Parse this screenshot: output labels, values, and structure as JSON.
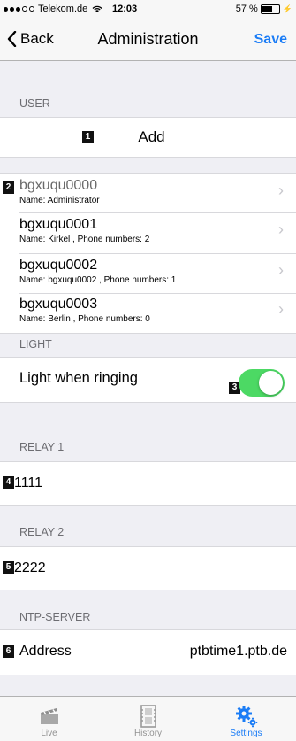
{
  "status_bar": {
    "carrier": "Telekom.de",
    "time": "12:03",
    "battery": "57 %"
  },
  "nav": {
    "back_label": "Back",
    "title": "Administration",
    "save_label": "Save"
  },
  "sections": {
    "user": "USER",
    "light": "LIGHT",
    "relay1": "RELAY 1",
    "relay2": "RELAY 2",
    "ntp": "NTP-SERVER"
  },
  "add_label": "Add",
  "users": [
    {
      "id": "bgxuqu0000",
      "detail": "Name: Administrator"
    },
    {
      "id": "bgxuqu0001",
      "detail": "Name: Kirkel , Phone numbers: 2"
    },
    {
      "id": "bgxuqu0002",
      "detail": "Name: bgxuqu0002 , Phone numbers: 1"
    },
    {
      "id": "bgxuqu0003",
      "detail": "Name: Berlin , Phone numbers: 0"
    }
  ],
  "light": {
    "label": "Light when ringing",
    "enabled": true
  },
  "relay1_value": "1111",
  "relay2_value": "2222",
  "ntp": {
    "label": "Address",
    "value": "ptbtime1.ptb.de"
  },
  "callouts": [
    "1",
    "2",
    "3",
    "4",
    "5",
    "6"
  ],
  "tabs": [
    {
      "label": "Live",
      "icon": "clapperboard-icon"
    },
    {
      "label": "History",
      "icon": "film-strip-icon"
    },
    {
      "label": "Settings",
      "icon": "gears-icon"
    }
  ],
  "colors": {
    "accent": "#1a7cf6",
    "toggle_on": "#4cd964"
  }
}
